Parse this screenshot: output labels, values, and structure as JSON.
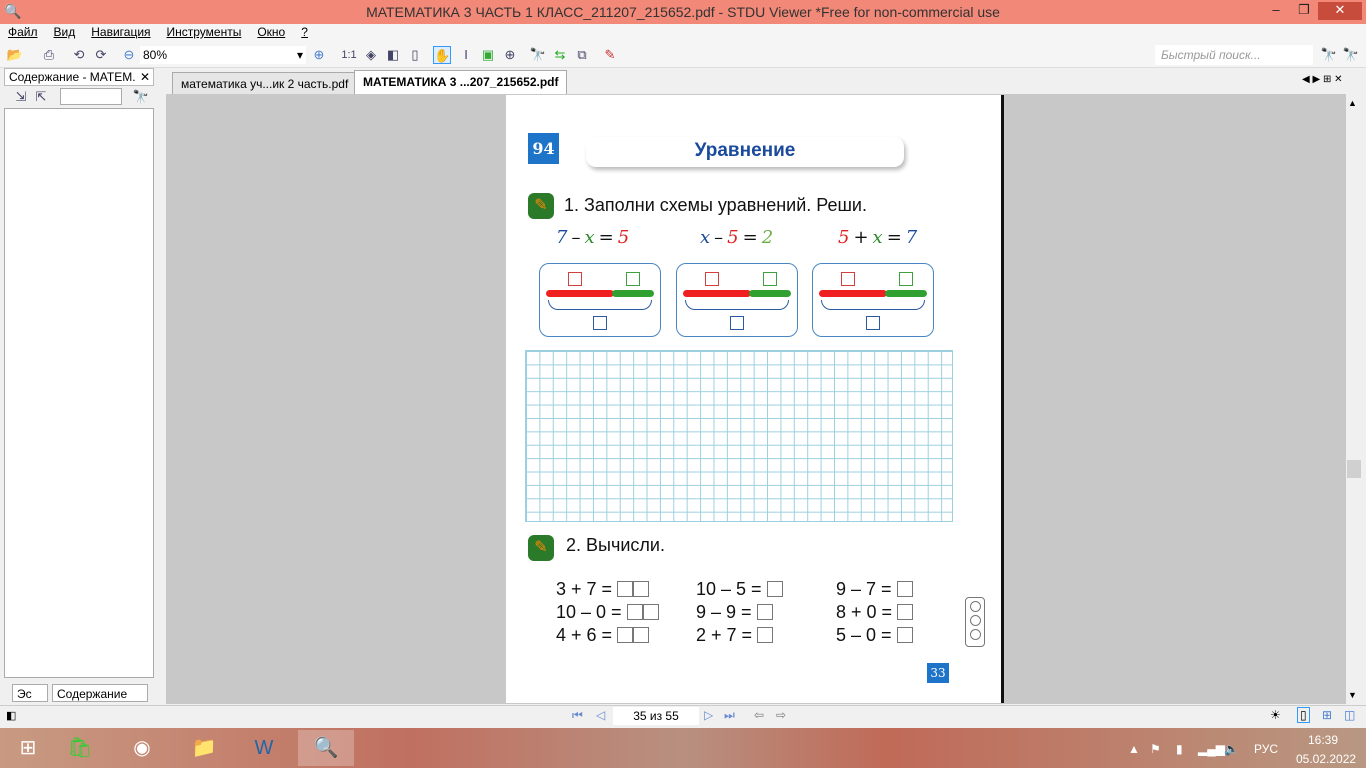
{
  "window": {
    "title": "МАТЕМАТИКА 3 ЧАСТЬ 1 КЛАСС_211207_215652.pdf - STDU Viewer *Free for non-commercial use",
    "min": "–",
    "restore": "❐",
    "close": "✕"
  },
  "menu": [
    "Файл",
    "Вид",
    "Навигация",
    "Инструменты",
    "Окно",
    "?"
  ],
  "toolbar": {
    "zoom": "80%",
    "zoom_arrow": "▾",
    "actual_size": "1:1",
    "quick_search_placeholder": "Быстрый поиск..."
  },
  "left_panel": {
    "title": "Содержание - МАТЕМ.",
    "close": "✕",
    "tabs": [
      "Эс",
      "Содержание"
    ]
  },
  "tabs": [
    {
      "label": "математика уч...ик 2 часть.pdf"
    },
    {
      "label": "МАТЕМАТИКА 3 ...207_215652.pdf"
    }
  ],
  "page": {
    "number": "94",
    "title": "Уравнение",
    "task1": "1. Заполни схемы уравнений. Реши.",
    "equations": [
      [
        {
          "t": "7",
          "c": "#1a4a9c"
        },
        {
          "t": "–",
          "c": "#111"
        },
        {
          "t": "x",
          "c": "#2a8a2a"
        },
        {
          "t": "=",
          "c": "#111"
        },
        {
          "t": "5",
          "c": "#e02020"
        }
      ],
      [
        {
          "t": "x",
          "c": "#1a4a9c"
        },
        {
          "t": "–",
          "c": "#111"
        },
        {
          "t": "5",
          "c": "#e02020"
        },
        {
          "t": "=",
          "c": "#111"
        },
        {
          "t": "2",
          "c": "#6ab040"
        }
      ],
      [
        {
          "t": "5",
          "c": "#e02020"
        },
        {
          "t": "+",
          "c": "#111"
        },
        {
          "t": "x",
          "c": "#2a8a2a"
        },
        {
          "t": "=",
          "c": "#111"
        },
        {
          "t": "7",
          "c": "#1a4a9c"
        }
      ]
    ],
    "task2": "2. Вычисли.",
    "calc": [
      [
        "3 + 7 =",
        "10 – 5 =",
        "9 – 7 ="
      ],
      [
        "10 – 0 =",
        "9 – 9 =",
        "8 + 0 ="
      ],
      [
        "4 + 6 =",
        "2 + 7 =",
        "5 – 0 ="
      ]
    ],
    "calc_boxes": [
      [
        2,
        1,
        1
      ],
      [
        2,
        1,
        1
      ],
      [
        2,
        1,
        1
      ]
    ],
    "footer_number": "33"
  },
  "nav": {
    "page_indicator": "35 из 55"
  },
  "tray": {
    "lang": "РУС",
    "time": "16:39",
    "date": "05.02.2022"
  }
}
